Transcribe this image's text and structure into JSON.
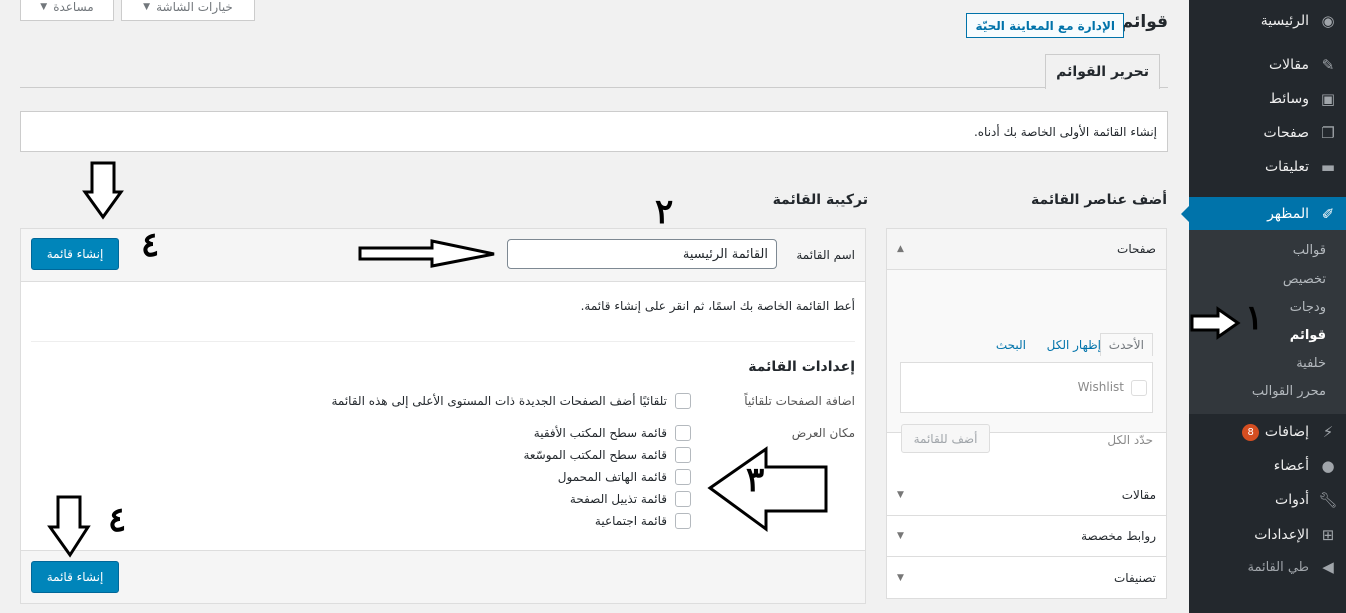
{
  "sidebar": {
    "items": [
      {
        "label": "الرئيسية",
        "icon": "dashboard-icon"
      },
      {
        "label": "مقالات",
        "icon": "pin-icon"
      },
      {
        "label": "وسائط",
        "icon": "media-icon"
      },
      {
        "label": "صفحات",
        "icon": "pages-icon"
      },
      {
        "label": "تعليقات",
        "icon": "comments-icon"
      },
      {
        "label": "المظهر",
        "icon": "brush-icon"
      },
      {
        "label": "إضافات",
        "icon": "plugins-icon",
        "badge": "8"
      },
      {
        "label": "أعضاء",
        "icon": "users-icon"
      },
      {
        "label": "أدوات",
        "icon": "tools-icon"
      },
      {
        "label": "الإعدادات",
        "icon": "settings-icon"
      },
      {
        "label": "طي القائمة",
        "icon": "collapse-icon"
      }
    ],
    "appearance_sub": [
      "قوالب",
      "تخصيص",
      "ودجات",
      "قوائم",
      "خلفية",
      "محرر القوالب"
    ]
  },
  "screen": {
    "options": "خيارات الشاشة",
    "help": "مساعدة"
  },
  "header": {
    "title": "قوائم",
    "live_preview": "الإدارة مع المعاينة الحيّة",
    "tab": "تحرير القوائم"
  },
  "notice": "إنشاء القائمة الأولى الخاصة بك أدناه.",
  "left": {
    "title": "أضف عناصر القائمة",
    "pages_title": "صفحات",
    "tabs": [
      "الأحدث",
      "إظهار الكل",
      "البحث"
    ],
    "item": "Wishlist",
    "select_all": "حدّد الكل",
    "add_button": "أضف للقائمة",
    "sections": [
      "مقالات",
      "روابط مخصصة",
      "تصنيفات"
    ]
  },
  "right": {
    "title": "تركيبة القائمة",
    "name_label": "اسم القائمة",
    "name_value": "القائمة الرئيسية",
    "create_button": "إنشاء قائمة",
    "hint": "أعط القائمة الخاصة بك اسمًا، ثم انقر على إنشاء قائمة.",
    "settings_title": "إعدادات القائمة",
    "auto_add_label": "اضافة الصفحات تلقائياً",
    "auto_add_text": "تلقائيًا أضف الصفحات الجديدة ذات المستوى الأعلى إلى هذه القائمة",
    "location_label": "مكان العرض",
    "locations": [
      "قائمة سطح المكتب الأفقية",
      "قائمة سطح المكتب الموسّعة",
      "قائمة الهاتف المحمول",
      "قائمة تذييل الصفحة",
      "قائمة اجتماعية"
    ]
  },
  "annotations": [
    "١",
    "٢",
    "٣",
    "٤",
    "٤"
  ]
}
